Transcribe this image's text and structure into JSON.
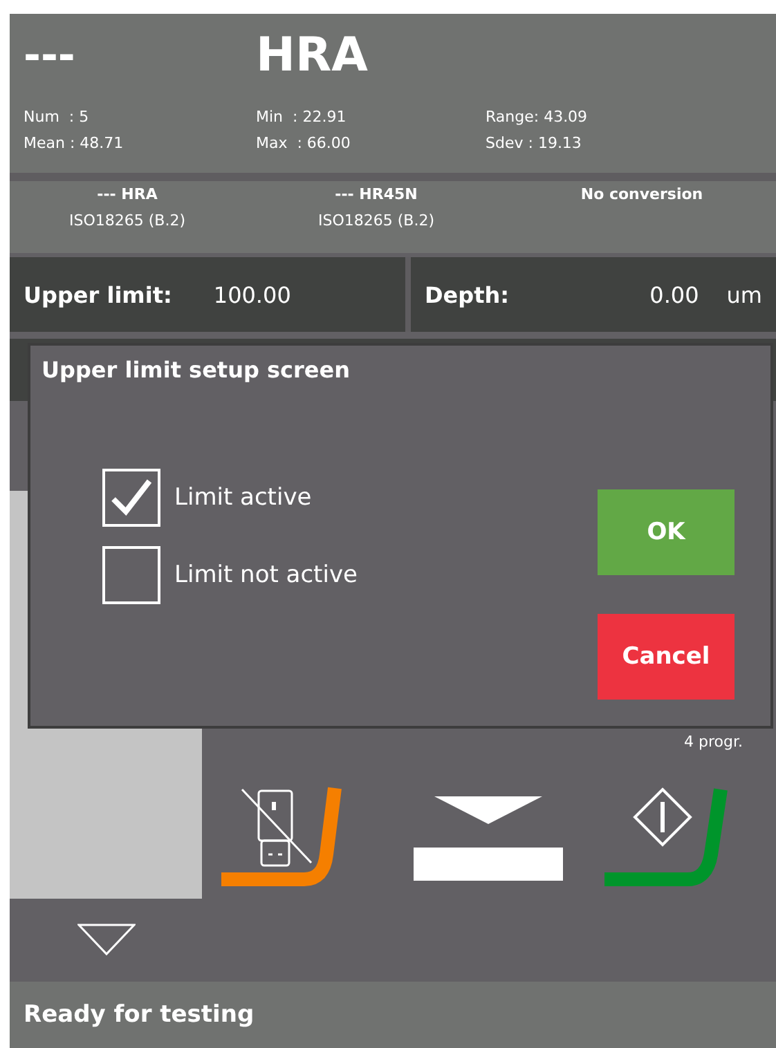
{
  "header": {
    "reading": "---",
    "scale": "HRA"
  },
  "stats": [
    "Num  : 5",
    "Min  : 22.91",
    "Range: 43.09",
    "Mean : 48.71",
    "Max  : 66.00",
    "Sdev : 19.13"
  ],
  "conversions": [
    {
      "scale": "--- HRA",
      "standard": "ISO18265 (B.2)"
    },
    {
      "scale": "--- HR45N",
      "standard": "ISO18265 (B.2)"
    },
    {
      "scale": "No conversion"
    }
  ],
  "limit": {
    "label": "Upper limit:",
    "value": "100.00"
  },
  "depth": {
    "label": "Depth:",
    "value": "0.00",
    "unit": "um"
  },
  "dialog": {
    "title": "Upper limit setup screen",
    "options": [
      {
        "label": "Limit active",
        "checked": true
      },
      {
        "label": "Limit not active",
        "checked": false
      }
    ],
    "buttons": [
      {
        "label": "OK",
        "kind": "ok"
      },
      {
        "label": "Cancel",
        "kind": "cancel"
      }
    ]
  },
  "program_count": "4 progr.",
  "actions": [
    {
      "kind": "usb"
    },
    {
      "kind": "lower"
    },
    {
      "kind": "start"
    }
  ],
  "status_bar": "Ready for testing"
}
